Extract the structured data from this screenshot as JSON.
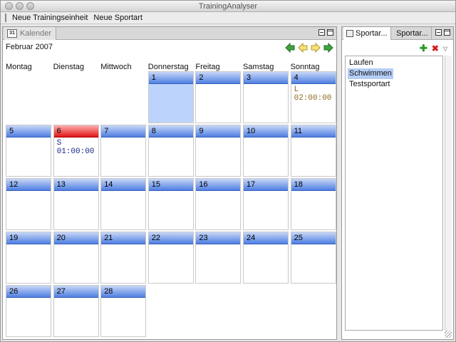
{
  "window": {
    "title": "TrainingAnalyser"
  },
  "menu": {
    "items": [
      "Neue Trainingseinheit",
      "Neue Sportart"
    ]
  },
  "calendar": {
    "tab_label": "Kalender",
    "tab_icon_text": "31",
    "month": "Februar 2007",
    "weekdays": [
      "Montag",
      "Dienstag",
      "Mittwoch",
      "Donnerstag",
      "Freitag",
      "Samstag",
      "Sonntag"
    ],
    "weeks": [
      [
        {
          "day": ""
        },
        {
          "day": ""
        },
        {
          "day": ""
        },
        {
          "day": "1",
          "selected": true
        },
        {
          "day": "2"
        },
        {
          "day": "3"
        },
        {
          "day": "4",
          "entry": "L 02:00:00",
          "entry_type": "l"
        }
      ],
      [
        {
          "day": "5"
        },
        {
          "day": "6",
          "today": true,
          "entry": "S 01:00:00",
          "entry_type": "s"
        },
        {
          "day": "7"
        },
        {
          "day": "8"
        },
        {
          "day": "9"
        },
        {
          "day": "10"
        },
        {
          "day": "11"
        }
      ],
      [
        {
          "day": "12"
        },
        {
          "day": "13"
        },
        {
          "day": "14"
        },
        {
          "day": "15"
        },
        {
          "day": "16"
        },
        {
          "day": "17"
        },
        {
          "day": "18"
        }
      ],
      [
        {
          "day": "19"
        },
        {
          "day": "20"
        },
        {
          "day": "21"
        },
        {
          "day": "22"
        },
        {
          "day": "23"
        },
        {
          "day": "24"
        },
        {
          "day": "25"
        }
      ],
      [
        {
          "day": "26"
        },
        {
          "day": "27"
        },
        {
          "day": "28"
        }
      ]
    ]
  },
  "sidepanel": {
    "tabs": [
      "Sportar...",
      "Sportar..."
    ],
    "sports": [
      {
        "name": "Laufen"
      },
      {
        "name": "Schwimmen",
        "selected": true
      },
      {
        "name": "Testsportart"
      }
    ]
  },
  "colors": {
    "day_header": "#4f7fe2",
    "today_header": "#e01515",
    "selected_day": "#bcd4fb",
    "selection": "#b5cdf6"
  }
}
